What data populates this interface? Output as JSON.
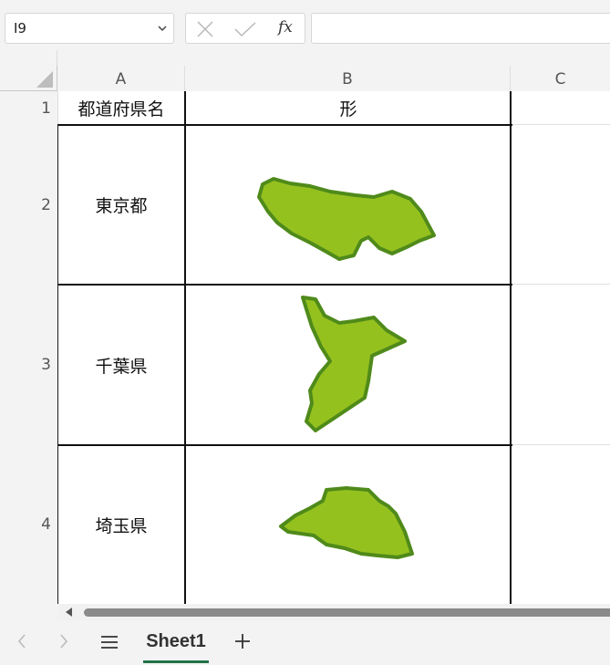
{
  "formula_bar": {
    "name_box": "I9",
    "function_label": "fx",
    "formula": ""
  },
  "columns": [
    "A",
    "B",
    "C"
  ],
  "rows": [
    "1",
    "2",
    "3",
    "4"
  ],
  "cells": {
    "A1": "都道府県名",
    "B1": "形",
    "A2": "東京都",
    "A3": "千葉県",
    "A4": "埼玉県"
  },
  "shapes": [
    {
      "row": "2",
      "name": "tokyo-shape",
      "icon": "prefecture-map"
    },
    {
      "row": "3",
      "name": "chiba-shape",
      "icon": "prefecture-map"
    },
    {
      "row": "4",
      "name": "saitama-shape",
      "icon": "prefecture-map"
    }
  ],
  "colors": {
    "map_fill": "#95c11f",
    "map_edge": "#4f8a1a",
    "tab_accent": "#217346"
  },
  "tabs": {
    "active": "Sheet1",
    "add_label": "+"
  }
}
